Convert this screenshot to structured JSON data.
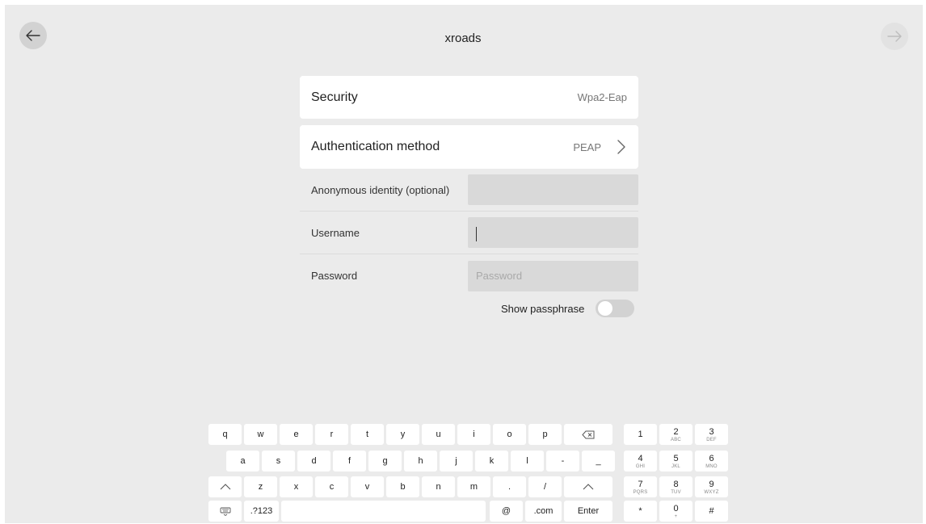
{
  "header": {
    "title": "xroads",
    "back_icon": "arrow-left-icon",
    "next_icon": "arrow-right-icon"
  },
  "security": {
    "label": "Security",
    "value": "Wpa2-Eap"
  },
  "auth_method": {
    "label": "Authentication method",
    "value": "PEAP",
    "icon": "chevron-right-icon"
  },
  "fields": {
    "anonymous": {
      "label": "Anonymous identity (optional)",
      "value": "",
      "placeholder": ""
    },
    "username": {
      "label": "Username",
      "value": "",
      "placeholder": ""
    },
    "password": {
      "label": "Password",
      "value": "",
      "placeholder": "Password"
    }
  },
  "show_passphrase": {
    "label": "Show passphrase",
    "enabled": false
  },
  "keyboard": {
    "row1": [
      "q",
      "w",
      "e",
      "r",
      "t",
      "y",
      "u",
      "i",
      "o",
      "p"
    ],
    "row2": [
      "a",
      "s",
      "d",
      "f",
      "g",
      "h",
      "j",
      "k",
      "l",
      "-",
      "_"
    ],
    "row3": [
      "z",
      "x",
      "c",
      "v",
      "b",
      "n",
      "m",
      ".",
      "/"
    ],
    "row4": {
      "symbols": ".?123",
      "at": "@",
      "com": ".com",
      "enter": "Enter"
    },
    "icons": {
      "backspace": "backspace-icon",
      "shift": "shift-up-icon",
      "emoji": "keyboard-hide-icon"
    },
    "numpad": [
      {
        "key": "1",
        "sub": ""
      },
      {
        "key": "2",
        "sub": "ABC"
      },
      {
        "key": "3",
        "sub": "DEF"
      },
      {
        "key": "4",
        "sub": "GHI"
      },
      {
        "key": "5",
        "sub": "JKL"
      },
      {
        "key": "6",
        "sub": "MNO"
      },
      {
        "key": "7",
        "sub": "PQRS"
      },
      {
        "key": "8",
        "sub": "TUV"
      },
      {
        "key": "9",
        "sub": "WXYZ"
      },
      {
        "key": "*",
        "sub": ""
      },
      {
        "key": "0",
        "sub": "+"
      },
      {
        "key": "#",
        "sub": ""
      }
    ]
  },
  "colors": {
    "background": "#ebebeb",
    "card": "#ffffff",
    "input": "#d9d9d9",
    "toggle_off": "#d2d2d2"
  }
}
